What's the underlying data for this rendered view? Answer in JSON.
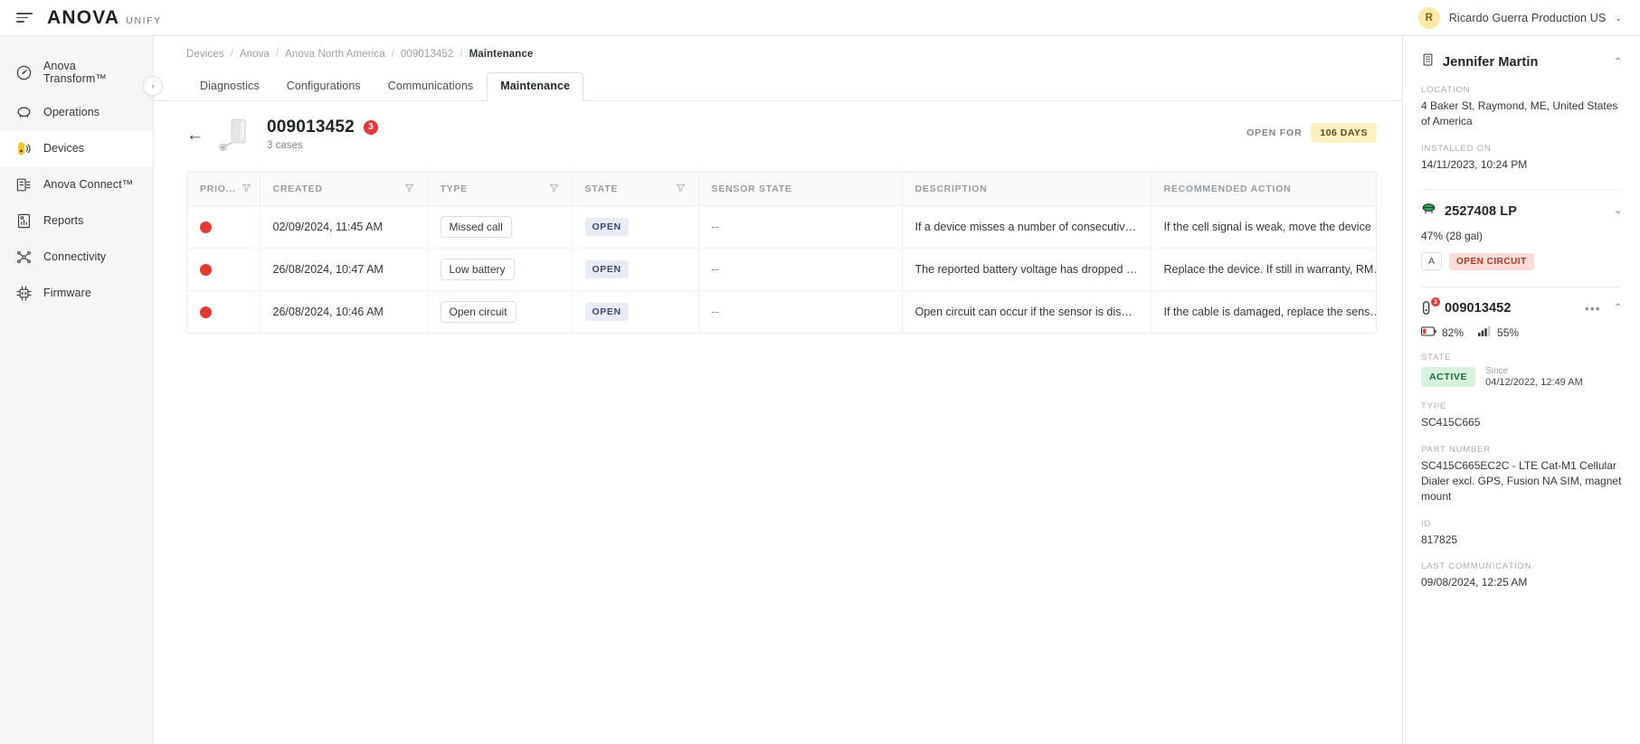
{
  "topbar": {
    "brand_main": "ANOVA",
    "brand_sub": "UNIFY",
    "user_initial": "R",
    "user_name": "Ricardo Guerra Production US",
    "caret": "⌄"
  },
  "sidebar": {
    "items": [
      {
        "label": "Anova Transform™",
        "icon": "gauge-icon",
        "active": false
      },
      {
        "label": "Operations",
        "icon": "chat-bubble-icon",
        "active": false
      },
      {
        "label": "Devices",
        "icon": "device-signal-icon",
        "active": true
      },
      {
        "label": "Anova Connect™",
        "icon": "connect-icon",
        "active": false
      },
      {
        "label": "Reports",
        "icon": "report-icon",
        "active": false
      },
      {
        "label": "Connectivity",
        "icon": "network-icon",
        "active": false
      },
      {
        "label": "Firmware",
        "icon": "chip-icon",
        "active": false
      }
    ],
    "collapse_caret": "›"
  },
  "breadcrumb": {
    "items": [
      "Devices",
      "Anova",
      "Anova North America",
      "009013452",
      "Maintenance"
    ],
    "separator": "/"
  },
  "tabs": [
    {
      "label": "Diagnostics",
      "active": false
    },
    {
      "label": "Configurations",
      "active": false
    },
    {
      "label": "Communications",
      "active": false
    },
    {
      "label": "Maintenance",
      "active": true
    }
  ],
  "device_header": {
    "back_arrow": "←",
    "title": "009013452",
    "case_count": "3",
    "subtitle": "3 cases",
    "open_for_label": "OPEN FOR",
    "open_for_value": "106 DAYS"
  },
  "table": {
    "columns": [
      {
        "label": "PRIO...",
        "filter": true
      },
      {
        "label": "CREATED",
        "filter": true
      },
      {
        "label": "TYPE",
        "filter": true
      },
      {
        "label": "STATE",
        "filter": true
      },
      {
        "label": "SENSOR STATE",
        "filter": false
      },
      {
        "label": "DESCRIPTION",
        "filter": false
      },
      {
        "label": "RECOMMENDED ACTION",
        "filter": false
      }
    ],
    "rows": [
      {
        "priority": "high",
        "created": "02/09/2024, 11:45 AM",
        "type": "Missed call",
        "state": "OPEN",
        "sensor_state": "--",
        "description": "If a device misses a number of consecutive ...",
        "recommended_action": "If the cell signal is weak, move the device to..."
      },
      {
        "priority": "high",
        "created": "26/08/2024, 10:47 AM",
        "type": "Low battery",
        "state": "OPEN",
        "sensor_state": "--",
        "description": "The reported battery voltage has dropped b...",
        "recommended_action": "Replace the device. If still in warranty, RMA ..."
      },
      {
        "priority": "high",
        "created": "26/08/2024, 10:46 AM",
        "type": "Open circuit",
        "state": "OPEN",
        "sensor_state": "--",
        "description": "Open circuit can occur if the sensor is disco...",
        "recommended_action": "If the cable is damaged, replace the sensor. ..."
      }
    ]
  },
  "right_panel": {
    "customer": {
      "name": "Jennifer Martin",
      "chevron": "⌃",
      "location_label": "LOCATION",
      "location_value": "4 Baker St, Raymond, ME, United States of America",
      "installed_label": "INSTALLED ON",
      "installed_value": "14/11/2023, 10:24 PM"
    },
    "tank": {
      "name": "2527408 LP",
      "chevron": "⌄",
      "level": "47% (28 gal)",
      "chip_a": "A",
      "chip_status": "OPEN CIRCUIT"
    },
    "device": {
      "name": "009013452",
      "badge": "3",
      "dots": "•••",
      "chevron": "⌃",
      "battery": "82%",
      "signal": "55%",
      "state_label": "STATE",
      "state_value": "ACTIVE",
      "since_label": "Since",
      "since_value": "04/12/2022, 12:49 AM",
      "type_label": "TYPE",
      "type_value": "SC415C665",
      "part_label": "PART NUMBER",
      "part_value": "SC415C665EC2C - LTE Cat-M1 Cellular Dialer excl. GPS, Fusion NA SIM, magnet mount",
      "id_label": "ID",
      "id_value": "817825",
      "last_comm_label": "LAST COMMUNICATION",
      "last_comm_value": "09/08/2024, 12:25 AM"
    }
  },
  "colors": {
    "priority_red": "#e8392e",
    "badge_red": "#e53935",
    "days_yellow_bg": "#fdf0c3",
    "state_blue_bg": "#e9ecf5",
    "active_green_bg": "#d6f2dd",
    "open_circuit_bg": "#fbdcd8",
    "avatar_yellow": "#fce9a8"
  }
}
